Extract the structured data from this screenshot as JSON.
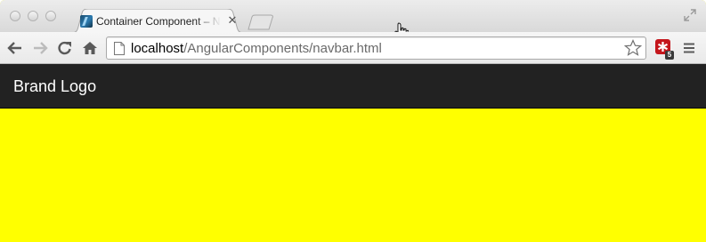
{
  "browser": {
    "tab": {
      "title": "Container Component – Navbar",
      "close_glyph": "✕",
      "favicon": "angular-favicon-icon"
    },
    "toolbar": {
      "url_host": "localhost",
      "url_path": "/AngularComponents/navbar.html"
    },
    "extension": {
      "badge": "5",
      "icon": "lastpass-extension-icon"
    }
  },
  "page": {
    "navbar": {
      "brand_label": "Brand Logo"
    },
    "colors": {
      "navbar_bg": "#222222",
      "container_bg": "#ffff00",
      "brand_text": "#ffffff"
    }
  }
}
